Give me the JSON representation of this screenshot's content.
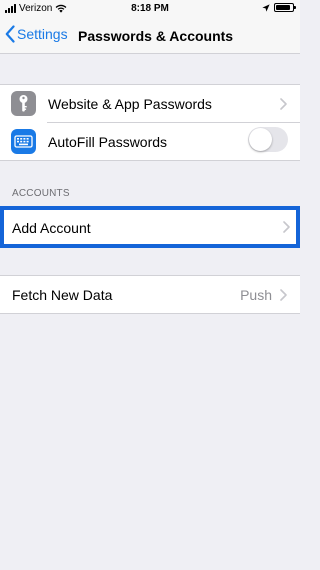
{
  "status_bar": {
    "carrier": "Verizon",
    "time": "8:18 PM",
    "battery_level": 0.85
  },
  "nav": {
    "back_label": "Settings",
    "title": "Passwords & Accounts"
  },
  "passwords_group": {
    "items": [
      {
        "label": "Website & App Passwords",
        "icon": "key-icon"
      },
      {
        "label": "AutoFill Passwords",
        "icon": "keyboard-icon",
        "toggle_on": false
      }
    ]
  },
  "accounts_section": {
    "header": "ACCOUNTS",
    "add_account_label": "Add Account"
  },
  "fetch_group": {
    "label": "Fetch New Data",
    "value": "Push"
  },
  "colors": {
    "accent": "#1a7ae6",
    "highlight": "#1464d8",
    "background": "#efeff4"
  }
}
